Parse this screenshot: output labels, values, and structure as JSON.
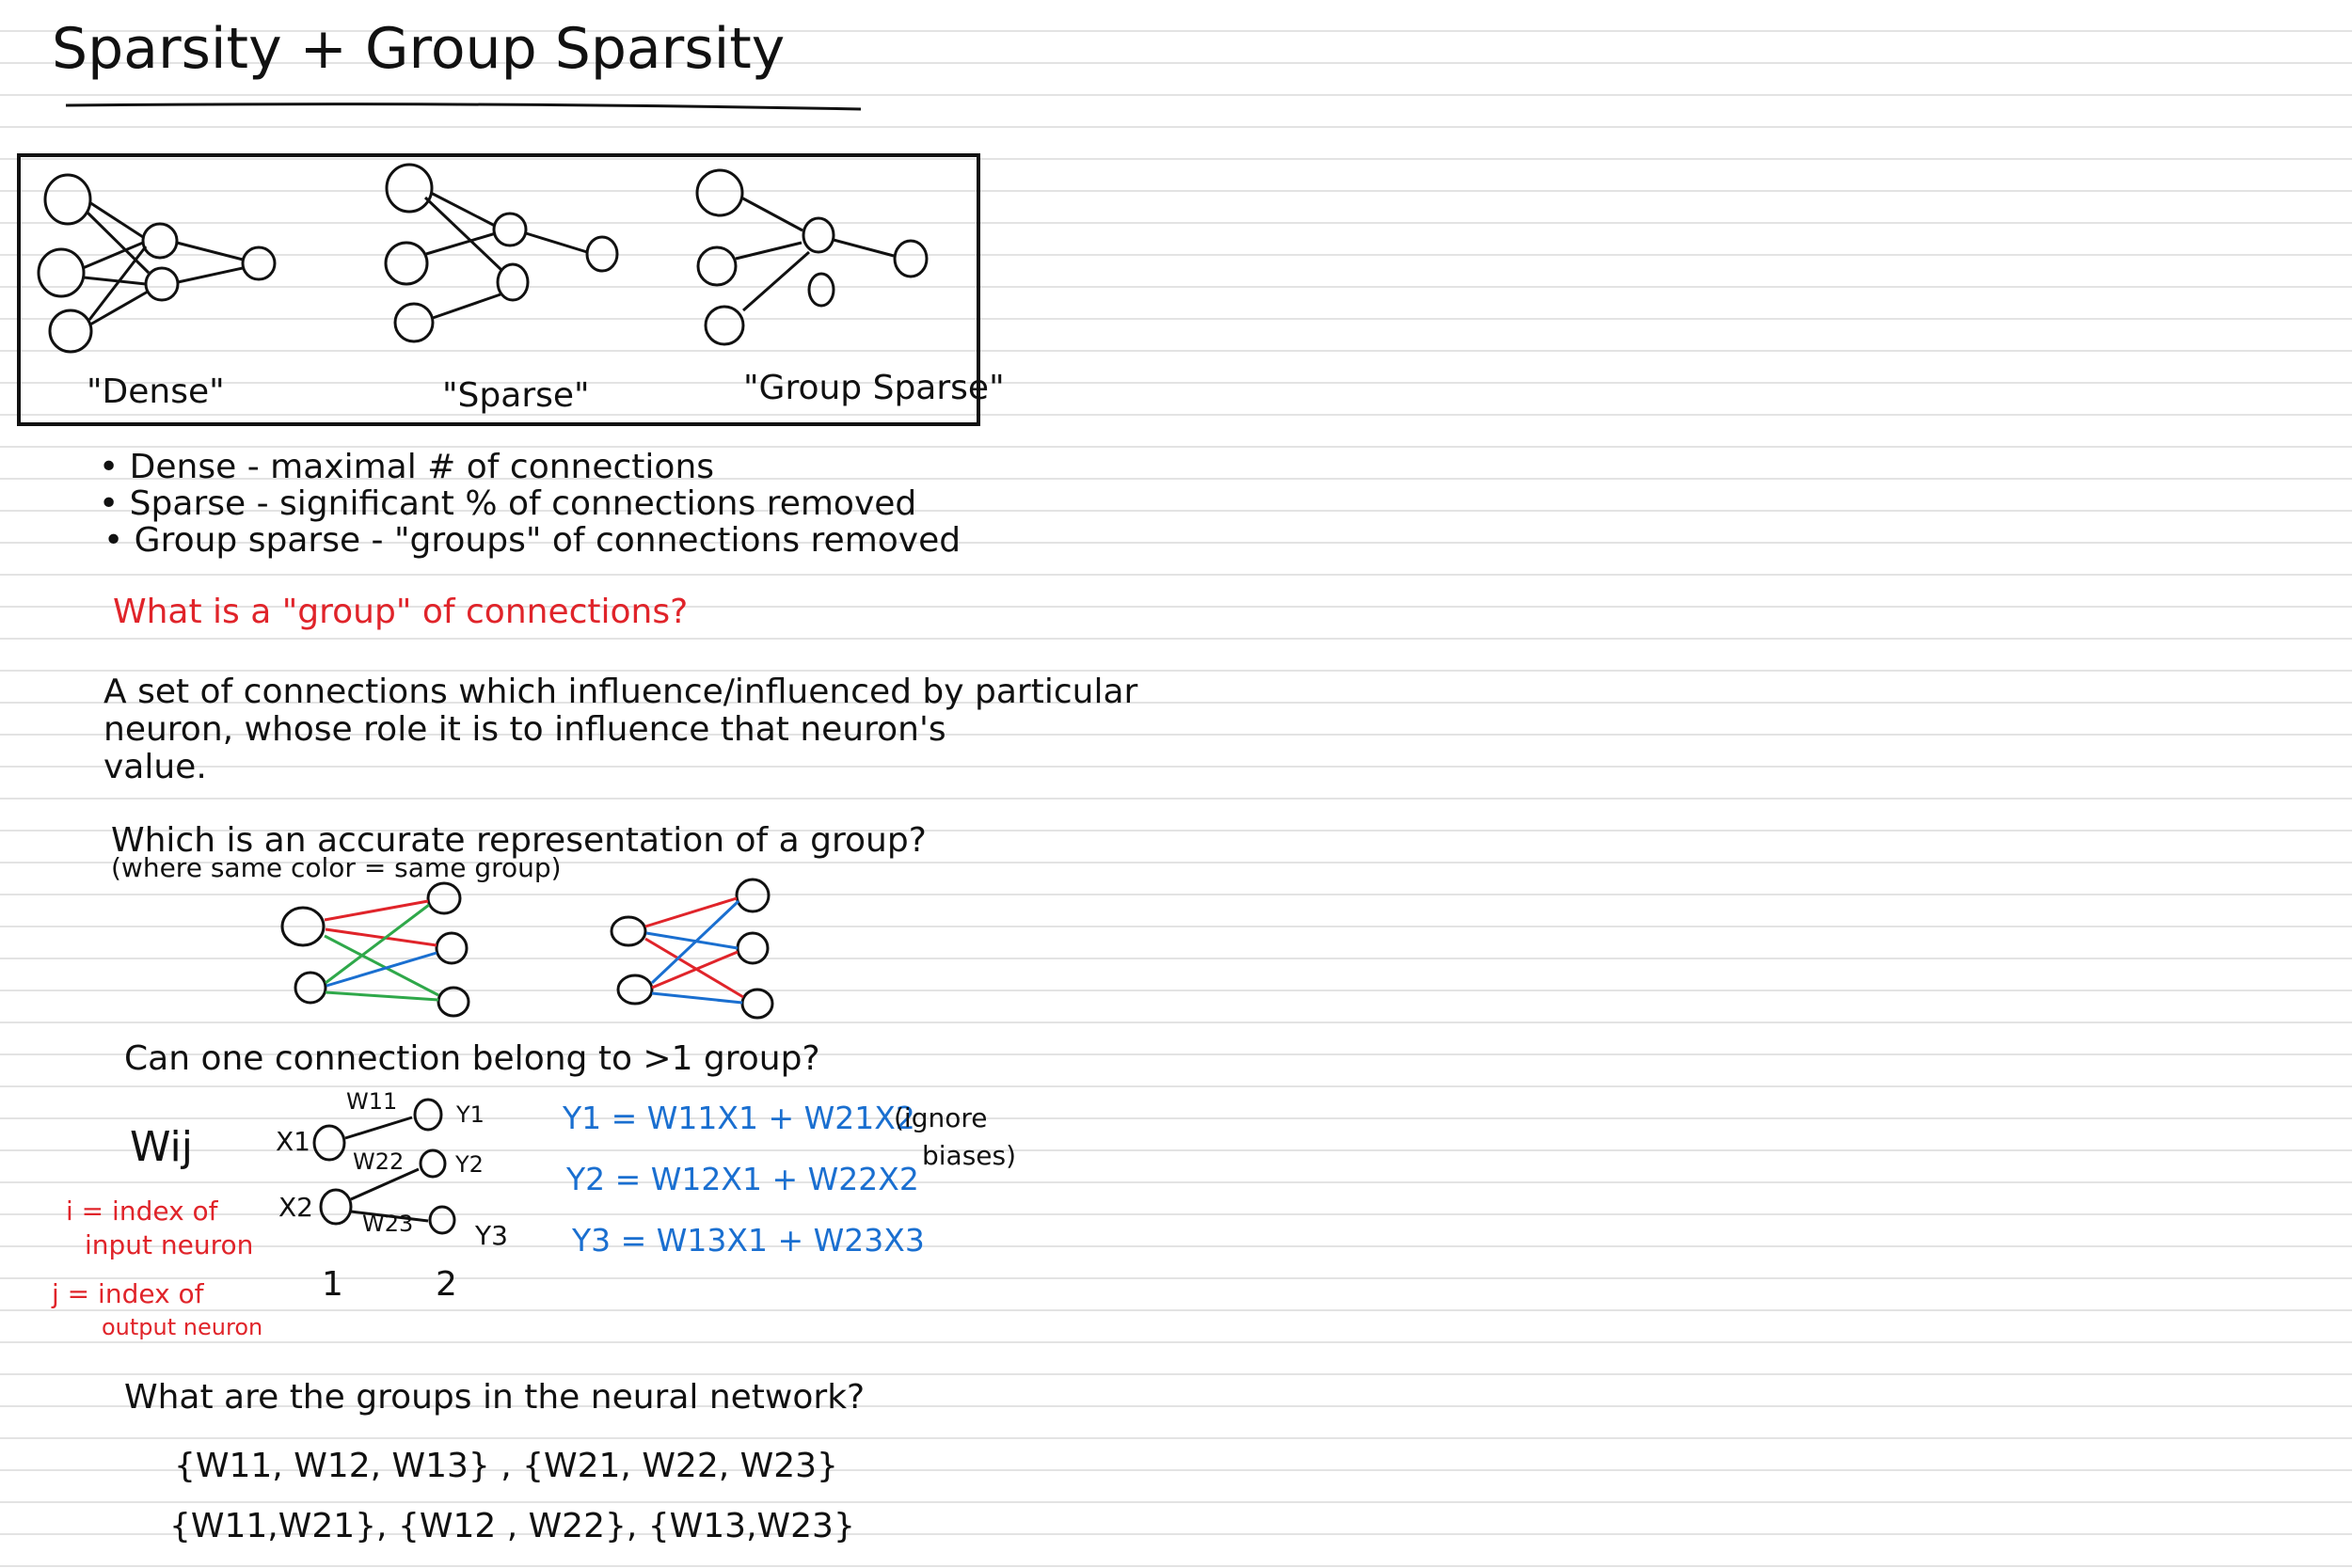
{
  "title": "Sparsity + Group Sparsity",
  "networks": {
    "dense_label": "\"Dense\"",
    "sparse_label": "\"Sparse\"",
    "group_sparse_label": "\"Group Sparse\""
  },
  "bullets": [
    "• Dense - maximal # of connections",
    "• Sparse - significant % of connections removed",
    "• Group sparse - \"groups\" of connections removed"
  ],
  "question_group": "What is a \"group\" of connections?",
  "definition_lines": [
    "A set of connections which influence/influenced by particular",
    "neuron, whose role it is to influence that neuron's",
    "value."
  ],
  "question_accurate": "Which is an accurate representation of a group?",
  "question_accurate_note": "(where same color = same group)",
  "question_overlap": "Can one connection belong to >1 group?",
  "notation": {
    "symbol": "Wij",
    "i_def_1": "i = index of",
    "i_def_2": "input neuron",
    "j_def_1": "j = index of",
    "j_def_2": "output neuron"
  },
  "diagram": {
    "x1": "X1",
    "x2": "X2",
    "y1": "Y1",
    "y2": "Y2",
    "y3": "Y3",
    "w11": "W11",
    "w22": "W22",
    "w23": "W23",
    "layer1": "1",
    "layer2": "2"
  },
  "equations": [
    "Y1 = W11X1 + W21X2",
    "Y2 = W12X1 + W22X2",
    "Y3 = W13X1 + W23X3"
  ],
  "ignore_note_1": "(ignore",
  "ignore_note_2": "biases)",
  "question_groups": "What are the groups in the neural network?",
  "answer_1": "{W11, W12, W13} , {W21, W22, W23}",
  "answer_2": "{W11,W21}, {W12 , W22}, {W13,W23}",
  "colors": {
    "ink": "#111111",
    "red": "#e0242a",
    "blue": "#1a6fd0",
    "green": "#2fa84a"
  }
}
